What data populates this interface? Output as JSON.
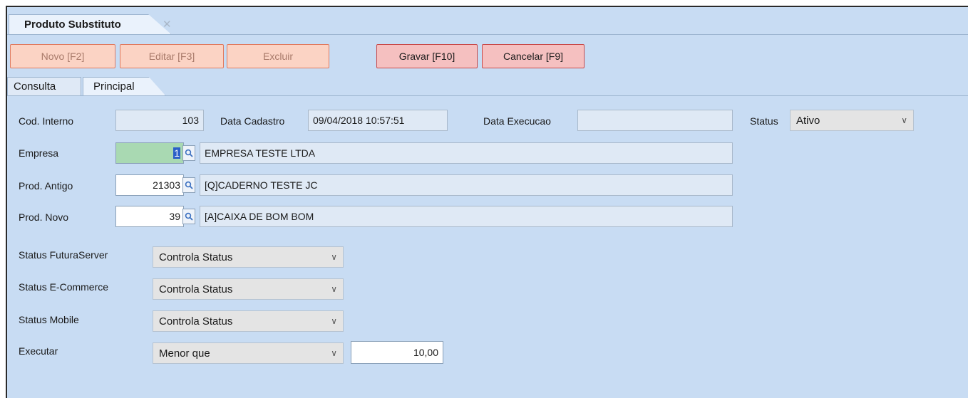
{
  "window": {
    "tab_title": "Produto Substituto",
    "close_glyph": "✕"
  },
  "toolbar": {
    "novo": "Novo [F2]",
    "editar": "Editar [F3]",
    "excluir": "Excluir",
    "gravar": "Gravar [F10]",
    "cancelar": "Cancelar [F9]"
  },
  "tabs": [
    {
      "label": "Consulta"
    },
    {
      "label": "Principal"
    }
  ],
  "form": {
    "cod_interno": {
      "label": "Cod. Interno",
      "value": "103"
    },
    "data_cadastro": {
      "label": "Data Cadastro",
      "value": "09/04/2018 10:57:51"
    },
    "data_execucao": {
      "label": "Data Execucao",
      "value": ""
    },
    "status": {
      "label": "Status",
      "value": "Ativo"
    },
    "empresa": {
      "label": "Empresa",
      "code": "1",
      "name": "EMPRESA TESTE LTDA"
    },
    "prod_antigo": {
      "label": "Prod. Antigo",
      "code": "21303",
      "name": "[Q]CADERNO TESTE JC"
    },
    "prod_novo": {
      "label": "Prod. Novo",
      "code": "39",
      "name": "[A]CAIXA DE BOM BOM"
    },
    "status_futuraserver": {
      "label": "Status FuturaServer",
      "value": "Controla Status"
    },
    "status_ecommerce": {
      "label": "Status E-Commerce",
      "value": "Controla Status"
    },
    "status_mobile": {
      "label": "Status Mobile",
      "value": "Controla Status"
    },
    "executar": {
      "label": "Executar",
      "value": "Menor que",
      "amount": "10,00"
    }
  },
  "icons": {
    "lookup": "magnifier-icon",
    "dropdown": "chevron-down-icon"
  }
}
